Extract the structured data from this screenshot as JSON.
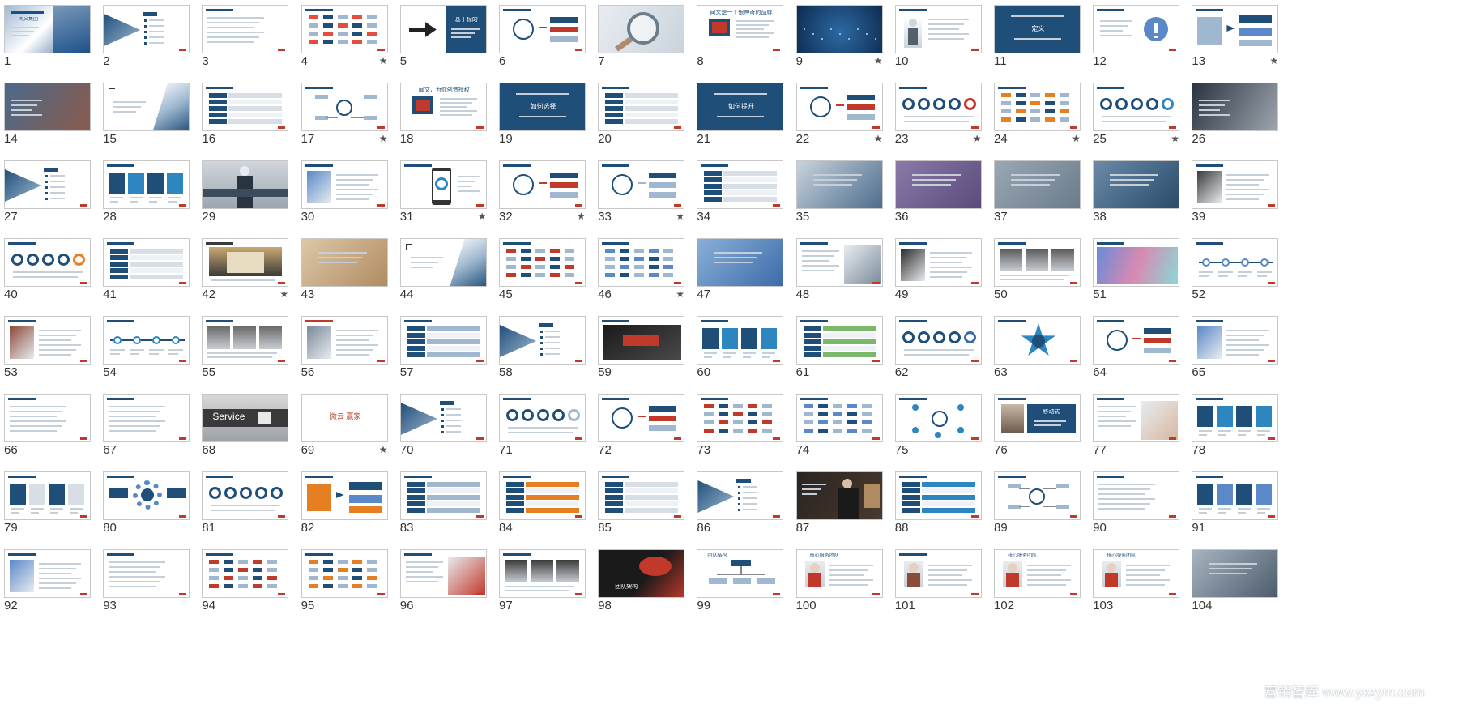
{
  "slide_sorter": {
    "slides": [
      {
        "n": "1",
        "star": false,
        "v": "photo-title",
        "title": "闻文集团",
        "c1": "#1a4f8a",
        "c2": "#9fb8d0"
      },
      {
        "n": "2",
        "star": false,
        "v": "agenda",
        "c1": "#1f4e79",
        "c2": "#9fb8d0"
      },
      {
        "n": "3",
        "star": false,
        "v": "text",
        "c1": "#1f4e79",
        "c2": "#d8dee6"
      },
      {
        "n": "4",
        "star": true,
        "v": "logos",
        "c1": "#1f4e79",
        "c2": "#e74c3c"
      },
      {
        "n": "5",
        "star": false,
        "v": "arrow",
        "title": "基于标的",
        "c1": "#1f4e79",
        "c2": "#ffffff"
      },
      {
        "n": "6",
        "star": false,
        "v": "diagram",
        "c1": "#1f4e79",
        "c2": "#c0392b"
      },
      {
        "n": "7",
        "star": false,
        "v": "magnifier",
        "c1": "#6b7c8a",
        "c2": "#d8dee6"
      },
      {
        "n": "8",
        "star": false,
        "v": "title-text",
        "title": "闻文是一个很神奇的品牌",
        "c1": "#1f4e79",
        "c2": "#c0392b"
      },
      {
        "n": "9",
        "star": true,
        "v": "dark-photo",
        "c1": "#0d2a4f",
        "c2": "#2d6aa3"
      },
      {
        "n": "10",
        "star": false,
        "v": "person",
        "c1": "#1f4e79",
        "c2": "#c9d3dd"
      },
      {
        "n": "11",
        "star": false,
        "v": "blue-block",
        "title": "定义",
        "c1": "#1f4e79",
        "c2": "#ffffff"
      },
      {
        "n": "12",
        "star": false,
        "v": "question",
        "c1": "#1f4e79",
        "c2": "#5a88c8"
      },
      {
        "n": "13",
        "star": true,
        "v": "flow",
        "c1": "#1f4e79",
        "c2": "#9fb8d0"
      },
      {
        "n": "14",
        "star": false,
        "v": "photo-text",
        "c1": "#4a6a8a",
        "c2": "#8c5a4a"
      },
      {
        "n": "15",
        "star": false,
        "v": "corner-photo",
        "c1": "#1f4e79",
        "c2": "#9fb8d0"
      },
      {
        "n": "16",
        "star": false,
        "v": "table",
        "c1": "#1f4e79",
        "c2": "#d8dee6"
      },
      {
        "n": "17",
        "star": true,
        "v": "mindmap",
        "c1": "#1f4e79",
        "c2": "#9fb8d0"
      },
      {
        "n": "18",
        "star": false,
        "v": "title-text",
        "title": "闻文，为你创造授权",
        "c1": "#1f4e79",
        "c2": "#c0392b"
      },
      {
        "n": "19",
        "star": false,
        "v": "blue-block",
        "title": "如何选择",
        "c1": "#1f4e79",
        "c2": "#ffffff"
      },
      {
        "n": "20",
        "star": false,
        "v": "table",
        "c1": "#1f4e79",
        "c2": "#d8dee6"
      },
      {
        "n": "21",
        "star": false,
        "v": "blue-block",
        "title": "如何提升",
        "c1": "#1f4e79",
        "c2": "#ffffff"
      },
      {
        "n": "22",
        "star": true,
        "v": "diagram",
        "c1": "#1f4e79",
        "c2": "#c0392b"
      },
      {
        "n": "23",
        "star": true,
        "v": "circles",
        "c1": "#1f4e79",
        "c2": "#c0392b"
      },
      {
        "n": "24",
        "star": true,
        "v": "logos",
        "c1": "#1f4e79",
        "c2": "#e67e22"
      },
      {
        "n": "25",
        "star": true,
        "v": "circles",
        "c1": "#1f4e79",
        "c2": "#2e86c1"
      },
      {
        "n": "26",
        "star": false,
        "v": "photo-text",
        "c1": "#2a3440",
        "c2": "#a0a8b0"
      },
      {
        "n": "27",
        "star": false,
        "v": "agenda",
        "c1": "#1f4e79",
        "c2": "#9fb8d0"
      },
      {
        "n": "28",
        "star": false,
        "v": "columns",
        "c1": "#1f4e79",
        "c2": "#2e86c1"
      },
      {
        "n": "29",
        "star": false,
        "v": "banner-person",
        "c1": "#3c4c5c",
        "c2": "#9fb8d0"
      },
      {
        "n": "30",
        "star": false,
        "v": "photo-left",
        "c1": "#1f4e79",
        "c2": "#5a88c8"
      },
      {
        "n": "31",
        "star": true,
        "v": "phone",
        "c1": "#1f4e79",
        "c2": "#2e86c1"
      },
      {
        "n": "32",
        "star": true,
        "v": "diagram",
        "c1": "#1f4e79",
        "c2": "#c0392b"
      },
      {
        "n": "33",
        "star": true,
        "v": "diagram",
        "c1": "#1f4e79",
        "c2": "#9fb8d0"
      },
      {
        "n": "34",
        "star": false,
        "v": "table",
        "c1": "#1f4e79",
        "c2": "#d8dee6"
      },
      {
        "n": "35",
        "star": false,
        "v": "photo-full",
        "c1": "#4a6a8a",
        "c2": "#c9d3dd"
      },
      {
        "n": "36",
        "star": false,
        "v": "photo-full",
        "c1": "#5a4a7a",
        "c2": "#8a7aa8"
      },
      {
        "n": "37",
        "star": false,
        "v": "photo-full",
        "c1": "#6a7a8a",
        "c2": "#9aa8b4"
      },
      {
        "n": "38",
        "star": false,
        "v": "photo-full",
        "c1": "#2a4a6a",
        "c2": "#6a8aa8"
      },
      {
        "n": "39",
        "star": false,
        "v": "photo-left",
        "c1": "#1f4e79",
        "c2": "#3a3a3a"
      },
      {
        "n": "40",
        "star": false,
        "v": "circles",
        "c1": "#1f4e79",
        "c2": "#e67e22"
      },
      {
        "n": "41",
        "star": false,
        "v": "table",
        "c1": "#1f4e79",
        "c2": "#d8dee6"
      },
      {
        "n": "42",
        "star": true,
        "v": "photo-center",
        "c1": "#3a3a3a",
        "c2": "#c9a870"
      },
      {
        "n": "43",
        "star": false,
        "v": "photo-full",
        "c1": "#b08a60",
        "c2": "#dcc8a8"
      },
      {
        "n": "44",
        "star": false,
        "v": "corner-photo",
        "c1": "#1f4e79",
        "c2": "#9fb8d0"
      },
      {
        "n": "45",
        "star": false,
        "v": "logos",
        "c1": "#1f4e79",
        "c2": "#c0392b"
      },
      {
        "n": "46",
        "star": true,
        "v": "logos",
        "c1": "#1f4e79",
        "c2": "#5a88c8"
      },
      {
        "n": "47",
        "star": false,
        "v": "photo-full",
        "c1": "#3a6aa8",
        "c2": "#8ab0d8"
      },
      {
        "n": "48",
        "star": false,
        "v": "photo-right",
        "c1": "#1f4e79",
        "c2": "#7a8a9a"
      },
      {
        "n": "49",
        "star": false,
        "v": "photo-left",
        "c1": "#1f4e79",
        "c2": "#2a2a2a"
      },
      {
        "n": "50",
        "star": false,
        "v": "photo-grid",
        "c1": "#1f4e79",
        "c2": "#5a5a5a"
      },
      {
        "n": "51",
        "star": false,
        "v": "gradient",
        "c1": "#6a8ad8",
        "c2": "#d88ab0"
      },
      {
        "n": "52",
        "star": false,
        "v": "timeline",
        "c1": "#1f4e79",
        "c2": "#5a88c8"
      },
      {
        "n": "53",
        "star": false,
        "v": "photo-left",
        "c1": "#1f4e79",
        "c2": "#8c4a3a"
      },
      {
        "n": "54",
        "star": false,
        "v": "timeline",
        "c1": "#1f4e79",
        "c2": "#2e86c1"
      },
      {
        "n": "55",
        "star": false,
        "v": "photo-grid",
        "c1": "#1f4e79",
        "c2": "#6a6a6a"
      },
      {
        "n": "56",
        "star": false,
        "v": "photo-left",
        "c1": "#c0392b",
        "c2": "#7a8a9a"
      },
      {
        "n": "57",
        "star": false,
        "v": "table",
        "c1": "#1f4e79",
        "c2": "#9fb8d0"
      },
      {
        "n": "58",
        "star": false,
        "v": "agenda",
        "c1": "#1f4e79",
        "c2": "#9fb8d0"
      },
      {
        "n": "59",
        "star": false,
        "v": "photo-keyboard",
        "c1": "#c0392b",
        "c2": "#1a1a1a"
      },
      {
        "n": "60",
        "star": false,
        "v": "columns",
        "c1": "#1f4e79",
        "c2": "#2e86c1"
      },
      {
        "n": "61",
        "star": false,
        "v": "table",
        "c1": "#1f4e79",
        "c2": "#7ab86a"
      },
      {
        "n": "62",
        "star": false,
        "v": "circles",
        "c1": "#1f4e79",
        "c2": "#3a6aa8"
      },
      {
        "n": "63",
        "star": false,
        "v": "star-diagram",
        "c1": "#1f4e79",
        "c2": "#2e86c1"
      },
      {
        "n": "64",
        "star": false,
        "v": "diagram",
        "c1": "#1f4e79",
        "c2": "#c0392b"
      },
      {
        "n": "65",
        "star": false,
        "v": "photo-left",
        "c1": "#1f4e79",
        "c2": "#5a88c8"
      },
      {
        "n": "66",
        "star": false,
        "v": "text",
        "c1": "#1f4e79",
        "c2": "#d8dee6"
      },
      {
        "n": "67",
        "star": false,
        "v": "text",
        "c1": "#1f4e79",
        "c2": "#5a88c8"
      },
      {
        "n": "68",
        "star": false,
        "v": "service",
        "title": "Service",
        "c1": "#3a3a3a",
        "c2": "#d8d8d8"
      },
      {
        "n": "69",
        "star": true,
        "v": "red-text",
        "title": "微云 赢家",
        "c1": "#c0392b",
        "c2": "#ffffff"
      },
      {
        "n": "70",
        "star": false,
        "v": "agenda",
        "c1": "#1f4e79",
        "c2": "#9fb8d0"
      },
      {
        "n": "71",
        "star": false,
        "v": "circles",
        "c1": "#1f4e79",
        "c2": "#9fb8d0"
      },
      {
        "n": "72",
        "star": false,
        "v": "diagram",
        "c1": "#1f4e79",
        "c2": "#c0392b"
      },
      {
        "n": "73",
        "star": false,
        "v": "logos",
        "c1": "#1f4e79",
        "c2": "#c0392b"
      },
      {
        "n": "74",
        "star": false,
        "v": "logos",
        "c1": "#1f4e79",
        "c2": "#5a88c8"
      },
      {
        "n": "75",
        "star": false,
        "v": "network",
        "c1": "#1f4e79",
        "c2": "#2e86c1"
      },
      {
        "n": "76",
        "star": false,
        "v": "blue-card",
        "title": "移动式",
        "c1": "#1f4e79",
        "c2": "#ffffff"
      },
      {
        "n": "77",
        "star": false,
        "v": "photo-right",
        "c1": "#1f4e79",
        "c2": "#d8b8a0"
      },
      {
        "n": "78",
        "star": false,
        "v": "columns",
        "c1": "#1f4e79",
        "c2": "#2e86c1"
      },
      {
        "n": "79",
        "star": false,
        "v": "columns",
        "c1": "#1f4e79",
        "c2": "#d8dee6"
      },
      {
        "n": "80",
        "star": false,
        "v": "gear",
        "c1": "#1f4e79",
        "c2": "#5a88c8"
      },
      {
        "n": "81",
        "star": false,
        "v": "circles",
        "c1": "#1f4e79",
        "c2": "#1f4e79"
      },
      {
        "n": "82",
        "star": false,
        "v": "flow",
        "c1": "#1f4e79",
        "c2": "#e67e22"
      },
      {
        "n": "83",
        "star": false,
        "v": "table",
        "c1": "#1f4e79",
        "c2": "#9fb8d0"
      },
      {
        "n": "84",
        "star": false,
        "v": "table",
        "c1": "#1f4e79",
        "c2": "#e67e22"
      },
      {
        "n": "85",
        "star": false,
        "v": "table",
        "c1": "#1f4e79",
        "c2": "#d8dee6"
      },
      {
        "n": "86",
        "star": false,
        "v": "agenda",
        "c1": "#1f4e79",
        "c2": "#9fb8d0"
      },
      {
        "n": "87",
        "star": false,
        "v": "dark-person",
        "c1": "#2a2420",
        "c2": "#b08a60"
      },
      {
        "n": "88",
        "star": false,
        "v": "table",
        "c1": "#1f4e79",
        "c2": "#2e86c1"
      },
      {
        "n": "89",
        "star": false,
        "v": "mindmap",
        "c1": "#1f4e79",
        "c2": "#9fb8d0"
      },
      {
        "n": "90",
        "star": false,
        "v": "text",
        "c1": "#1f4e79",
        "c2": "#d8dee6"
      },
      {
        "n": "91",
        "star": false,
        "v": "columns",
        "c1": "#1f4e79",
        "c2": "#5a88c8"
      },
      {
        "n": "92",
        "star": false,
        "v": "photo-left",
        "c1": "#1f4e79",
        "c2": "#5a88c8"
      },
      {
        "n": "93",
        "star": false,
        "v": "text",
        "c1": "#1f4e79",
        "c2": "#d8dee6"
      },
      {
        "n": "94",
        "star": false,
        "v": "logos",
        "c1": "#1f4e79",
        "c2": "#c0392b"
      },
      {
        "n": "95",
        "star": false,
        "v": "logos",
        "c1": "#1f4e79",
        "c2": "#e67e22"
      },
      {
        "n": "96",
        "star": false,
        "v": "photo-right",
        "c1": "#1f4e79",
        "c2": "#c0392b"
      },
      {
        "n": "97",
        "star": false,
        "v": "photo-grid",
        "c1": "#1f4e79",
        "c2": "#3a3a3a"
      },
      {
        "n": "98",
        "star": false,
        "v": "dark-red",
        "title": "团队架构",
        "c1": "#1a1a1a",
        "c2": "#c0392b"
      },
      {
        "n": "99",
        "star": false,
        "v": "org",
        "title": "团队结构",
        "c1": "#1f4e79",
        "c2": "#9fb8d0"
      },
      {
        "n": "100",
        "star": false,
        "v": "profile",
        "title": "核心服务团队",
        "c1": "#1f4e79",
        "c2": "#c0392b"
      },
      {
        "n": "101",
        "star": false,
        "v": "profile",
        "c1": "#1f4e79",
        "c2": "#8c4a3a"
      },
      {
        "n": "102",
        "star": false,
        "v": "profile",
        "title": "核心服务团队",
        "c1": "#1f4e79",
        "c2": "#c0392b"
      },
      {
        "n": "103",
        "star": false,
        "v": "profile",
        "title": "核心服务团队",
        "c1": "#1f4e79",
        "c2": "#c0392b"
      },
      {
        "n": "104",
        "star": false,
        "v": "photo-full",
        "c1": "#4a5a6a",
        "c2": "#a8b4c0"
      }
    ]
  },
  "watermark": {
    "text": "营销智库 www.yxzym.com"
  },
  "colors": {
    "slide_number": "#333333",
    "thumb_border": "#c8c8c8",
    "brand_blue": "#1f4e79"
  },
  "icons": {
    "star": "star-icon"
  }
}
